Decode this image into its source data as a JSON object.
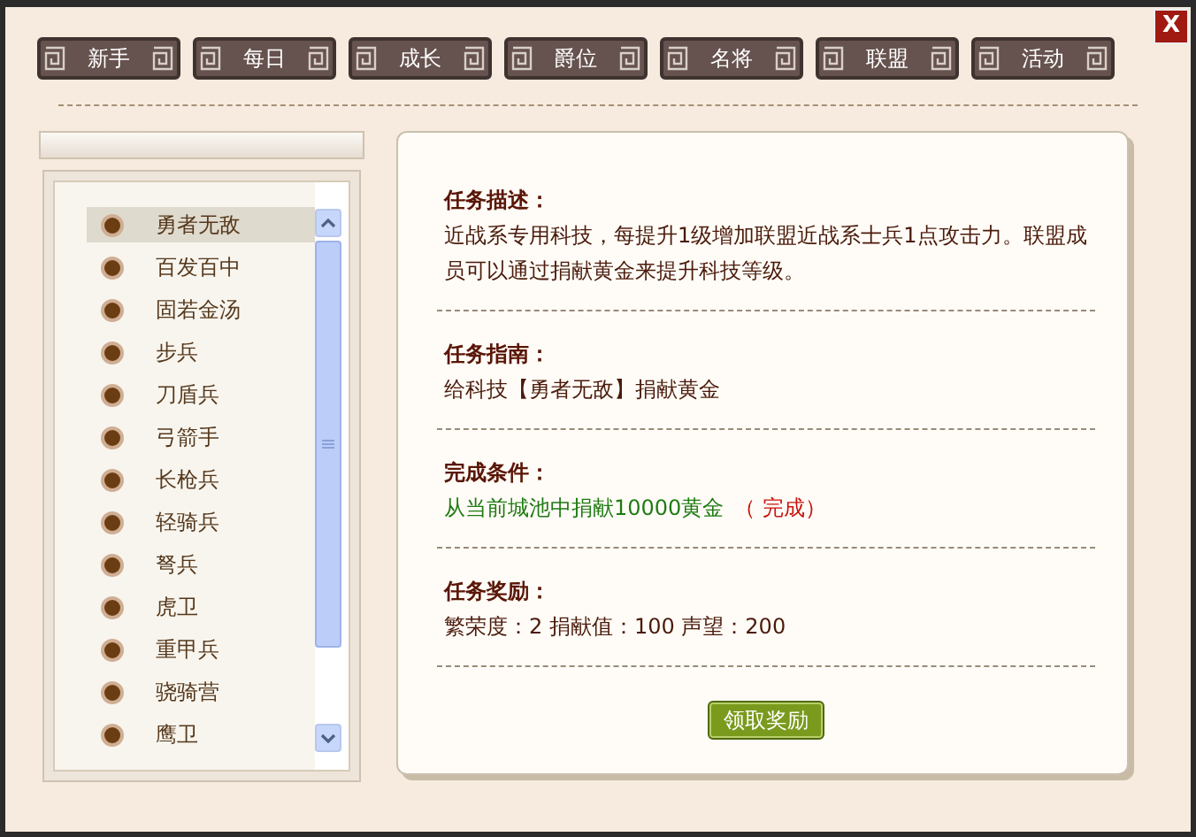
{
  "close_button": "X",
  "tabs": [
    {
      "label": "新手"
    },
    {
      "label": "每日"
    },
    {
      "label": "成长"
    },
    {
      "label": "爵位"
    },
    {
      "label": "名将"
    },
    {
      "label": "联盟"
    },
    {
      "label": "活动"
    }
  ],
  "task_list": [
    {
      "label": "勇者无敌",
      "selected": true
    },
    {
      "label": "百发百中",
      "selected": false
    },
    {
      "label": "固若金汤",
      "selected": false
    },
    {
      "label": "步兵",
      "selected": false
    },
    {
      "label": "刀盾兵",
      "selected": false
    },
    {
      "label": "弓箭手",
      "selected": false
    },
    {
      "label": "长枪兵",
      "selected": false
    },
    {
      "label": "轻骑兵",
      "selected": false
    },
    {
      "label": "弩兵",
      "selected": false
    },
    {
      "label": "虎卫",
      "selected": false
    },
    {
      "label": "重甲兵",
      "selected": false
    },
    {
      "label": "骁骑营",
      "selected": false
    },
    {
      "label": "鹰卫",
      "selected": false
    }
  ],
  "sections": [
    {
      "heading": "任务描述：",
      "kind": "text",
      "text": "近战系专用科技，每提升1级增加联盟近战系士兵1点攻击力。联盟成员可以通过捐献黄金来提升科技等级。"
    },
    {
      "heading": "任务指南：",
      "kind": "text",
      "text": "给科技【勇者无敌】捐献黄金"
    },
    {
      "heading": "完成条件：",
      "kind": "condition",
      "text": "从当前城池中捐献10000黄金",
      "status": "（ 完成）"
    },
    {
      "heading": "任务奖励：",
      "kind": "text",
      "text": "繁荣度：2 捐献值：100 声望：200"
    }
  ],
  "claim_button": "领取奖励"
}
